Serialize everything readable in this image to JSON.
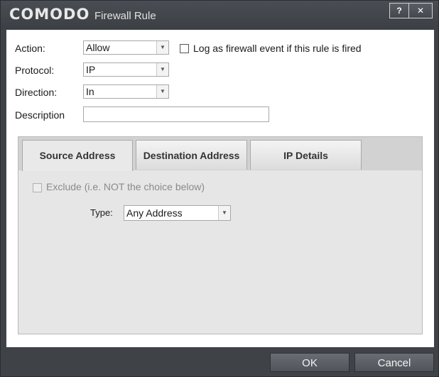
{
  "window": {
    "brand": "COMODO",
    "title": "Firewall Rule",
    "help_label": "?",
    "close_label": "✕"
  },
  "form": {
    "action_label": "Action:",
    "action_value": "Allow",
    "log_label": "Log as firewall event if this rule is fired",
    "log_checked": false,
    "protocol_label": "Protocol:",
    "protocol_value": "IP",
    "direction_label": "Direction:",
    "direction_value": "In",
    "description_label": "Description",
    "description_value": ""
  },
  "tabs": [
    {
      "label": "Source Address",
      "active": true
    },
    {
      "label": "Destination Address",
      "active": false
    },
    {
      "label": "IP Details",
      "active": false
    }
  ],
  "source_panel": {
    "exclude_label": "Exclude (i.e. NOT the choice below)",
    "exclude_checked": false,
    "exclude_enabled": false,
    "type_label": "Type:",
    "type_value": "Any Address"
  },
  "footer": {
    "ok_label": "OK",
    "cancel_label": "Cancel"
  },
  "colors": {
    "frame": "#3f4348",
    "content_bg": "#ffffff",
    "panel_bg": "#e6e6e6",
    "button_bg": "#5c6066"
  }
}
